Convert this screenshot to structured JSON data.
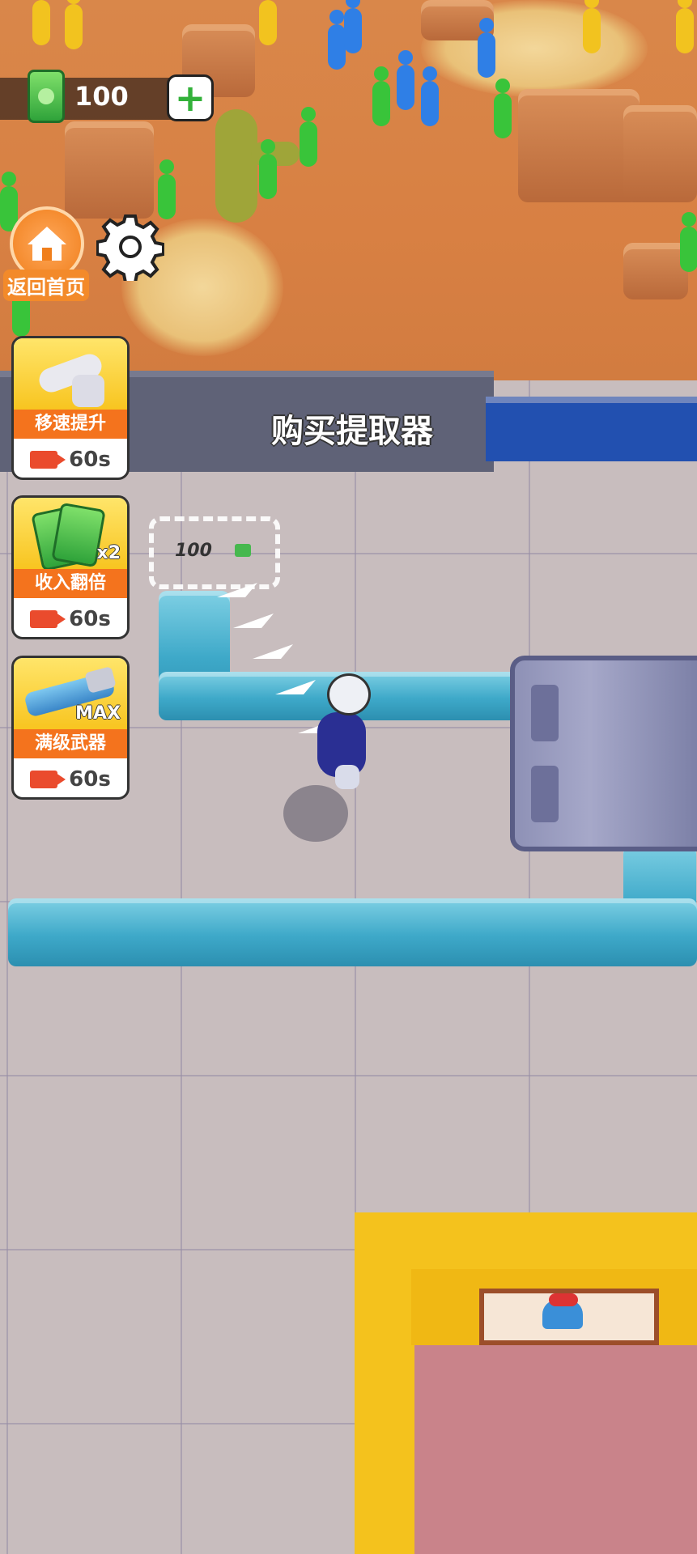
{
  "hud": {
    "currency": "100",
    "home_label": "返回首页"
  },
  "wall": {
    "title": "购买提取器"
  },
  "boosts": [
    {
      "label": "移速提升",
      "timer": "60s",
      "badge": ""
    },
    {
      "label": "收入翻倍",
      "timer": "60s",
      "badge": "x2"
    },
    {
      "label": "满级武器",
      "timer": "60s",
      "badge": "MAX"
    }
  ],
  "purchase": {
    "price": "100"
  },
  "colors": {
    "accent_orange": "#f4731d",
    "money_green": "#2fa33a",
    "building_yellow": "#f4c21d"
  }
}
